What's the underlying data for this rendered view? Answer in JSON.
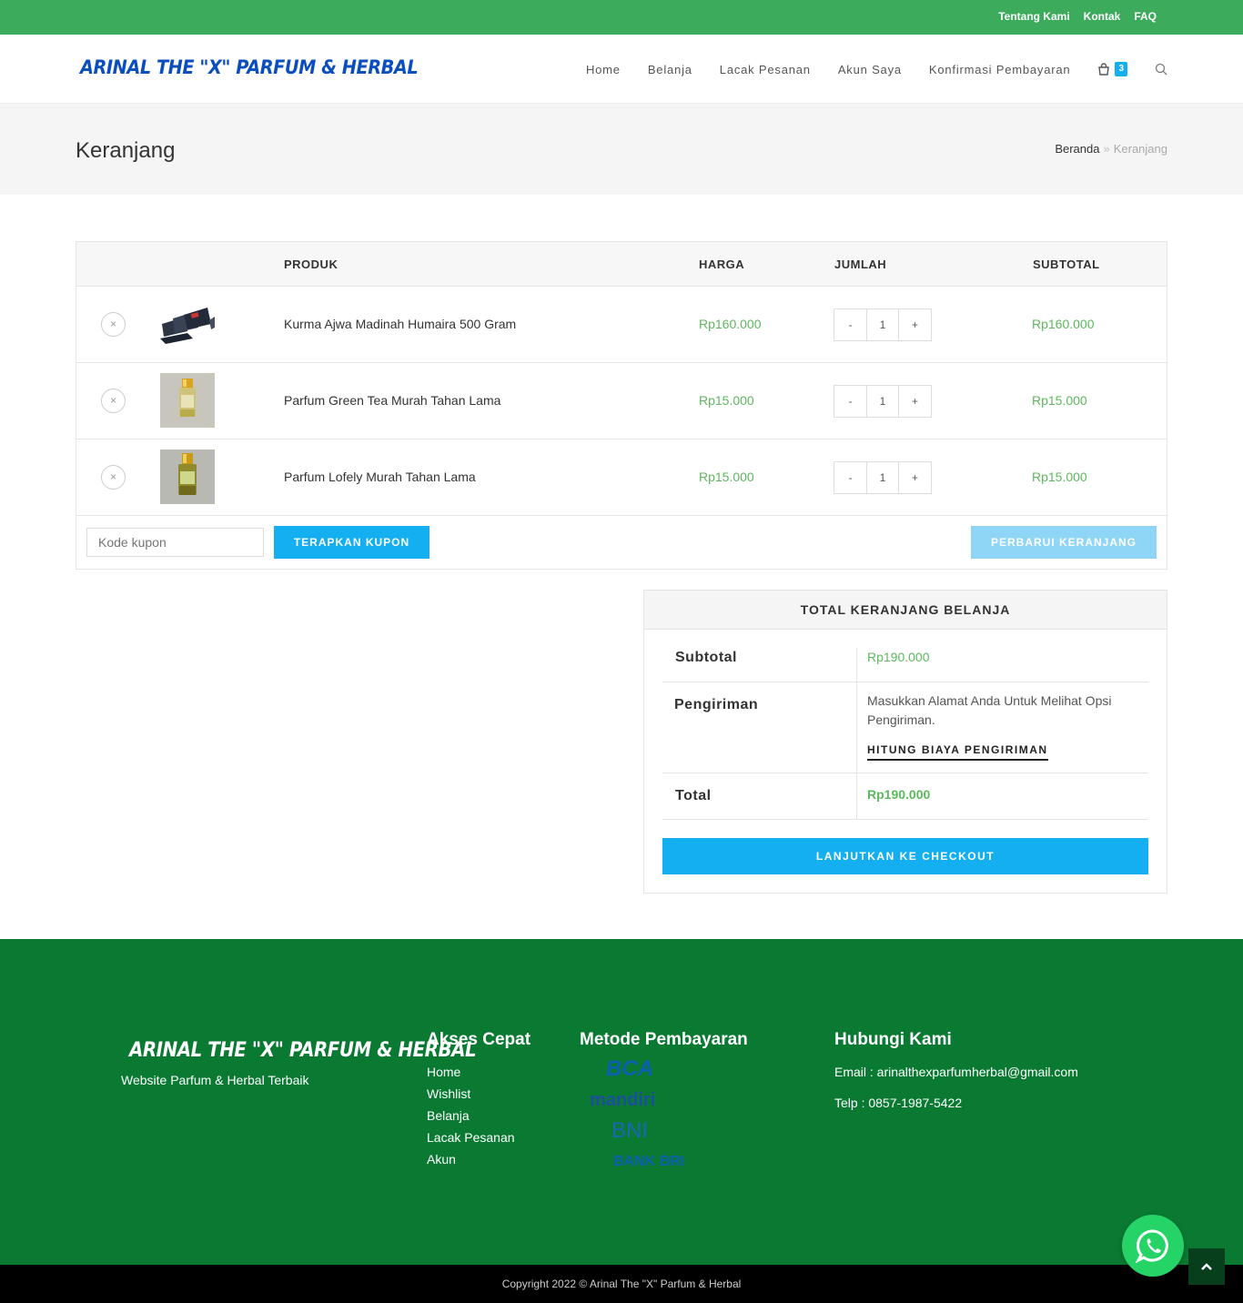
{
  "topbar": {
    "links": [
      "Tentang Kami",
      "Kontak",
      "FAQ"
    ]
  },
  "header": {
    "logo": "ARINAL THE \"X\" PARFUM & HERBAL",
    "nav": [
      "Home",
      "Belanja",
      "Lacak Pesanan",
      "Akun Saya",
      "Konfirmasi Pembayaran"
    ],
    "cart_count": "3"
  },
  "page": {
    "title": "Keranjang",
    "breadcrumb": {
      "home": "Beranda",
      "separator": "»",
      "current": "Keranjang"
    }
  },
  "cart": {
    "columns": {
      "product": "PRODUK",
      "price": "HARGA",
      "quantity": "JUMLAH",
      "subtotal": "SUBTOTAL"
    },
    "items": [
      {
        "name": "Kurma Ajwa Madinah Humaira 500 Gram",
        "price": "Rp160.000",
        "qty": "1",
        "subtotal": "Rp160.000"
      },
      {
        "name": "Parfum Green Tea Murah Tahan Lama",
        "price": "Rp15.000",
        "qty": "1",
        "subtotal": "Rp15.000"
      },
      {
        "name": "Parfum Lofely Murah Tahan Lama",
        "price": "Rp15.000",
        "qty": "1",
        "subtotal": "Rp15.000"
      }
    ],
    "remove_symbol": "×",
    "minus": "-",
    "plus": "+",
    "coupon_placeholder": "Kode kupon",
    "apply_coupon": "TERAPKAN KUPON",
    "update_cart": "PERBARUI KERANJANG"
  },
  "totals": {
    "heading": "TOTAL KERANJANG BELANJA",
    "subtotal_label": "Subtotal",
    "subtotal_value": "Rp190.000",
    "shipping_label": "Pengiriman",
    "shipping_text": "Masukkan Alamat Anda Untuk Melihat Opsi Pengiriman.",
    "calc_shipping": "HITUNG BIAYA PENGIRIMAN",
    "total_label": "Total",
    "total_value": "Rp190.000",
    "checkout": "LANJUTKAN KE CHECKOUT"
  },
  "footer": {
    "logo": "ARINAL THE \"X\" PARFUM & HERBAL",
    "tagline": "Website Parfum & Herbal Terbaik",
    "quick_heading": "Akses Cepat",
    "quick_links": [
      "Home",
      "Wishlist",
      "Belanja",
      "Lacak Pesanan",
      "Akun"
    ],
    "payment_heading": "Metode Pembayaran",
    "payment_methods": [
      "BCA",
      "mandiri",
      "BNI",
      "BANK BRI"
    ],
    "contact_heading": "Hubungi Kami",
    "email": "Email : arinalthexparfumherbal@gmail.com",
    "phone": "Telp : 0857-1987-5422",
    "copyright": "Copyright 2022 © Arinal The \"X\" Parfum & Herbal"
  },
  "colors": {
    "topbar": "#3cab5b",
    "accent": "#13aff0",
    "price": "#5cb85c",
    "footer": "#0a7a33",
    "logo": "#0b4fbf"
  }
}
